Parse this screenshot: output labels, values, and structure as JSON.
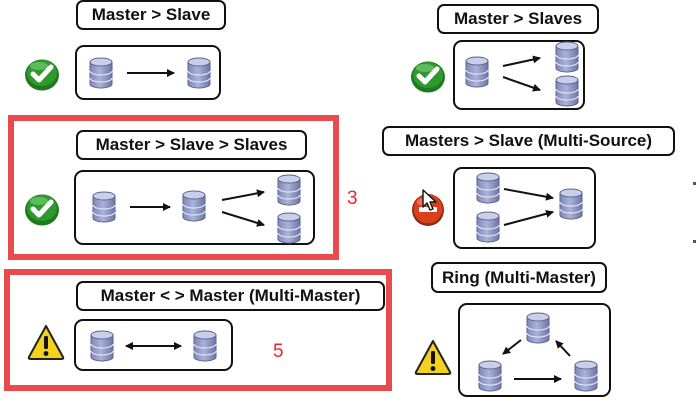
{
  "panels": [
    {
      "title": "Master > Slave",
      "status": "ok"
    },
    {
      "title": "Master > Slaves",
      "status": "ok"
    },
    {
      "title": "Master > Slave > Slaves",
      "status": "ok"
    },
    {
      "title": "Masters > Slave (Multi-Source)",
      "status": "error"
    },
    {
      "title": "Master < > Master (Multi-Master)",
      "status": "warning"
    },
    {
      "title": "Ring (Multi-Master)",
      "status": "warning"
    }
  ],
  "annotations": {
    "mark_3": "3",
    "mark_5": "5"
  },
  "colors": {
    "highlight_frame": "#e84a4e",
    "annotation_text": "#e8282d",
    "ok": "#2e9a2e",
    "error": "#d8411c",
    "warning": "#f2d21c",
    "database": "#aab2d8"
  },
  "icons": [
    "check-icon",
    "error-icon",
    "warning-icon",
    "database-icon",
    "cursor-icon"
  ]
}
